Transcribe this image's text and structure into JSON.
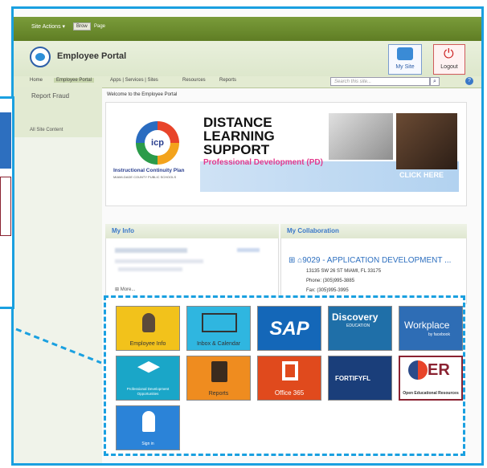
{
  "ribbon": {
    "site_actions": "Site Actions ▾",
    "browse": "Brow",
    "page": "Page"
  },
  "header": {
    "title": "Employee Portal",
    "my_site": "My Site",
    "logout": "Logout"
  },
  "nav": {
    "items": [
      "Home",
      "Employee Portal",
      "Apps | Services | Sites",
      "Resources",
      "Reports"
    ],
    "search_placeholder": "Search this site..."
  },
  "sidebar": {
    "report_fraud": "Report Fraud",
    "all_site_content": "All Site Content"
  },
  "main": {
    "welcome": "Welcome to the Employee Portal",
    "banner": {
      "logo_text": "icp",
      "caption": "Instructional Continuity Plan",
      "caption2": "MIAMI-DADE COUNTY PUBLIC SCHOOLS",
      "line1": "DISTANCE",
      "line2": "LEARNING",
      "line3": "SUPPORT",
      "line4": "Professional Development (PD)",
      "cta": "CLICK HERE"
    },
    "my_info": {
      "title": "My Info",
      "more": "⊞ More..."
    },
    "my_collaboration": {
      "title": "My Collaboration",
      "name": "⊞ ⌂9029 - APPLICATION DEVELOPMENT ...",
      "address": "13135 SW 26 ST MIAMI, FL 33175",
      "phone": "Phone: (305)995-3885",
      "fax": "Fax: (305)995-3995"
    },
    "apps": [
      {
        "label": "Employee Info",
        "bg": "#f2c21b"
      },
      {
        "label": "Inbox & Calendar",
        "bg": "#2fb6e0"
      },
      {
        "label": "SAP",
        "bg": "#1467b8"
      },
      {
        "label": "Discovery",
        "bg": "#1f6fa8"
      },
      {
        "label": "Workplace",
        "bg": "#2e6db5"
      },
      {
        "label": "Professional Development Opportunities",
        "bg": "#1aa6c8"
      },
      {
        "label": "Reports",
        "bg": "#ef8c1f"
      },
      {
        "label": "Office 365",
        "bg": "#e04a1d"
      },
      {
        "label": "FORTIFYFL",
        "bg": "#1a3e7a"
      },
      {
        "label": "Open Educational Resources",
        "bg": "#ffffff"
      },
      {
        "label": "Sign in",
        "bg": "#2b83d8"
      }
    ],
    "sap_text": "SAP",
    "discovery_text": "Discovery",
    "discovery_sub": "EDUCATION",
    "workplace_text": "Workplace",
    "workplace_sub": "by facebook",
    "fortify_text": "FORTIFYFL",
    "oer_text": "ER"
  }
}
